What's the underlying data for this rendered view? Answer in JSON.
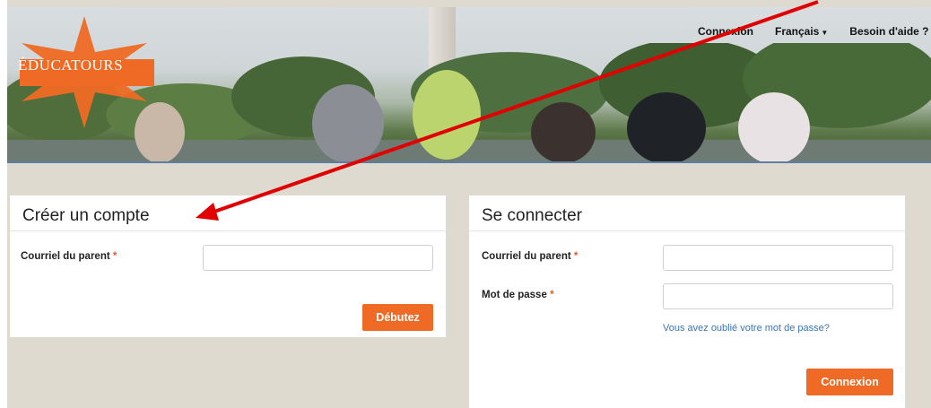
{
  "header": {
    "logo_text": "ÉDUCATOURS",
    "nav": {
      "login": "Connexion",
      "language": "Français",
      "help": "Besoin d'aide ?"
    }
  },
  "create_account": {
    "title": "Créer un compte",
    "email_label": "Courriel du parent",
    "required_mark": "*",
    "email_value": "",
    "submit_label": "Débutez"
  },
  "login": {
    "title": "Se connecter",
    "email_label": "Courriel du parent",
    "password_label": "Mot de passe",
    "required_mark": "*",
    "email_value": "",
    "password_value": "",
    "forgot_link": "Vous avez oublié votre mot de passe?",
    "submit_label": "Connexion"
  },
  "colors": {
    "accent": "#ef6a24",
    "link": "#3b76b5",
    "background": "#dedad0",
    "annotation_arrow": "#e00000"
  }
}
